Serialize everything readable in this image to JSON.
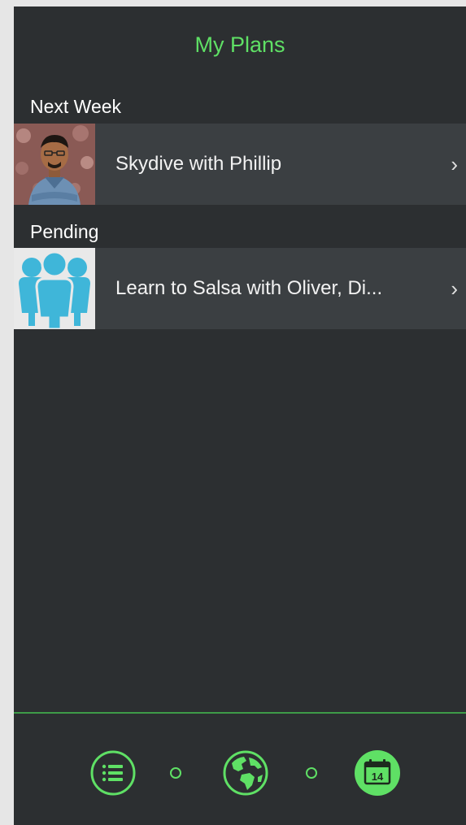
{
  "header": {
    "title": "My Plans"
  },
  "sections": [
    {
      "title": "Next Week",
      "items": [
        {
          "label": "Skydive with Phillip",
          "avatar": "person-photo"
        }
      ]
    },
    {
      "title": "Pending",
      "items": [
        {
          "label": "Learn to Salsa with Oliver, Di...",
          "avatar": "group-icon"
        }
      ]
    }
  ],
  "tabbar": {
    "items": [
      "list-icon",
      "globe-icon",
      "calendar-icon"
    ],
    "calendar_day": "14"
  },
  "colors": {
    "accent": "#5fe065",
    "background": "#2c2f31",
    "row_background": "#3b3f42",
    "group_icon": "#3fb6d9"
  }
}
